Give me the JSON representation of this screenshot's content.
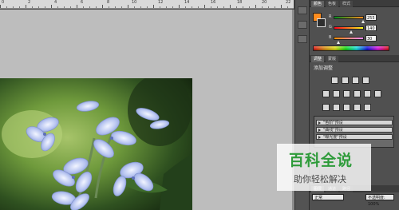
{
  "ruler": {
    "labels": [
      "0",
      "2",
      "4",
      "6",
      "8",
      "10",
      "12",
      "14",
      "16",
      "18",
      "20",
      "22"
    ]
  },
  "color_panel": {
    "tabs": [
      "颜色",
      "色板",
      "样式"
    ],
    "foreground_color": "#ff8c1e",
    "background_color": "#2e2e2e",
    "sliders": [
      {
        "label": "R",
        "value": "255",
        "level": 1.0
      },
      {
        "label": "G",
        "value": "140",
        "level": 0.55
      },
      {
        "label": "B",
        "value": "30",
        "level": 0.12
      }
    ]
  },
  "adjustments_panel": {
    "tabs": [
      "调整",
      "蒙版"
    ],
    "title": "添加调整",
    "presets": [
      {
        "label": "\"色阶\"预设"
      },
      {
        "label": "\"曲线\"预设"
      },
      {
        "label": "\"曝光度\"预设"
      }
    ]
  },
  "layers_panel": {
    "tabs": [
      "图层",
      "通道",
      "路径"
    ],
    "blend_mode": "正常",
    "opacity_label": "不透明度: 100%"
  },
  "watermark": {
    "title": "百科全说",
    "subtitle": "助你轻松解决"
  },
  "icons": [
    "move-tool-icon",
    "paint-tool-icon",
    "history-icon",
    "brightness-icon",
    "levels-icon",
    "curves-icon",
    "exposure-icon",
    "vibrance-icon",
    "hue-icon",
    "color-balance-icon",
    "bw-icon",
    "photo-filter-icon",
    "channel-mixer-icon",
    "invert-icon",
    "posterize-icon",
    "threshold-icon",
    "gradient-map-icon",
    "selective-color-icon"
  ]
}
